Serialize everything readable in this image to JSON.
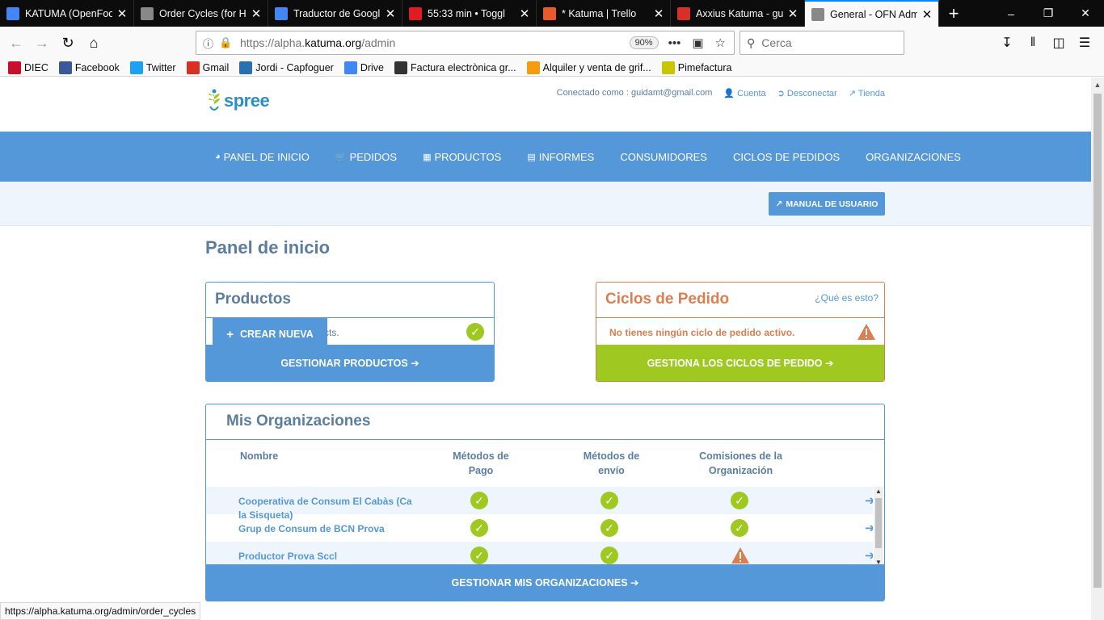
{
  "browser": {
    "tabs": [
      {
        "title": "KATUMA (OpenFoo",
        "icon": "docs-icon",
        "color": "#4285f4"
      },
      {
        "title": "Order Cycles (for H",
        "icon": "globe-icon",
        "color": "#888888"
      },
      {
        "title": "Traductor de Googl",
        "icon": "translate-icon",
        "color": "#4285f4"
      },
      {
        "title": "55:33 min • Toggl",
        "icon": "toggl-icon",
        "color": "#e01b22"
      },
      {
        "title": "* Katuma | Trello",
        "icon": "katuma-icon",
        "color": "#e85a2c"
      },
      {
        "title": "Axxius Katuma - gui",
        "icon": "gmail-icon",
        "color": "#d93025"
      },
      {
        "title": "General - OFN Adm",
        "icon": "globe-icon",
        "color": "#888888"
      }
    ],
    "url_prefix": "https://alpha.",
    "url_domain": "katuma.org",
    "url_path": "/admin",
    "zoom": "90%",
    "search_placeholder": "Cerca",
    "bookmarks": [
      {
        "label": "DIEC",
        "color": "#c8102e"
      },
      {
        "label": "Facebook",
        "color": "#3b5998"
      },
      {
        "label": "Twitter",
        "color": "#1da1f2"
      },
      {
        "label": "Gmail",
        "color": "#d93025"
      },
      {
        "label": "Jordi - Capfoguer",
        "color": "#2a6fb0"
      },
      {
        "label": "Drive",
        "color": "#4285f4"
      },
      {
        "label": "Factura electrònica gr...",
        "color": "#333333"
      },
      {
        "label": "Alquiler y venta de grif...",
        "color": "#f39c12"
      },
      {
        "label": "Pimefactura",
        "color": "#c9c600"
      }
    ],
    "status_url": "https://alpha.katuma.org/admin/order_cycles"
  },
  "header": {
    "logo_text": "spree",
    "logged_in_as": "Conectado como : guidamt@gmail.com",
    "account_link": "Cuenta",
    "logout_link": "Desconectar",
    "store_link": "Tienda"
  },
  "nav": {
    "items": [
      {
        "label": "PANEL DE INICIO",
        "icon": "dashboard-icon"
      },
      {
        "label": "PEDIDOS",
        "icon": "cart-icon"
      },
      {
        "label": "PRODUCTOS",
        "icon": "grid-icon"
      },
      {
        "label": "INFORMES",
        "icon": "file-icon"
      },
      {
        "label": "CONSUMIDORES",
        "icon": ""
      },
      {
        "label": "CICLOS DE PEDIDOS",
        "icon": ""
      },
      {
        "label": "ORGANIZACIONES",
        "icon": ""
      }
    ]
  },
  "manual_button": "MANUAL DE USUARIO",
  "page_title": "Panel de inicio",
  "products_panel": {
    "title": "Productos",
    "create_button": "CREAR NUEVA",
    "message_fragment": "cts.",
    "footer_button": "GESTIONAR PRODUCTOS ➔"
  },
  "cycles_panel": {
    "title": "Ciclos de Pedido",
    "help_link": "¿Qué es esto?",
    "message": "No tienes ningún ciclo de pedido activo.",
    "footer_button": "GESTIONA LOS CICLOS DE PEDIDO ➔"
  },
  "orgs_panel": {
    "title": "Mis Organizaciones",
    "columns": [
      "Nombre",
      "Métodos de Pago",
      "Métodos de envío",
      "Comisiones de la Organización"
    ],
    "rows": [
      {
        "name": "Cooperativa de Consum El Cabàs (Ca la Sisqueta)",
        "payment": "ok",
        "shipping": "ok",
        "fees": "ok"
      },
      {
        "name": "Grup de Consum de BCN Prova",
        "payment": "ok",
        "shipping": "ok",
        "fees": "ok"
      },
      {
        "name": "Productor Prova Sccl",
        "payment": "ok",
        "shipping": "ok",
        "fees": "warning"
      }
    ],
    "footer_button": "GESTIONAR MIS ORGANIZACIONES ➔"
  },
  "colors": {
    "primary": "#5498da",
    "success": "#9fc820",
    "warning": "#da7f52"
  }
}
